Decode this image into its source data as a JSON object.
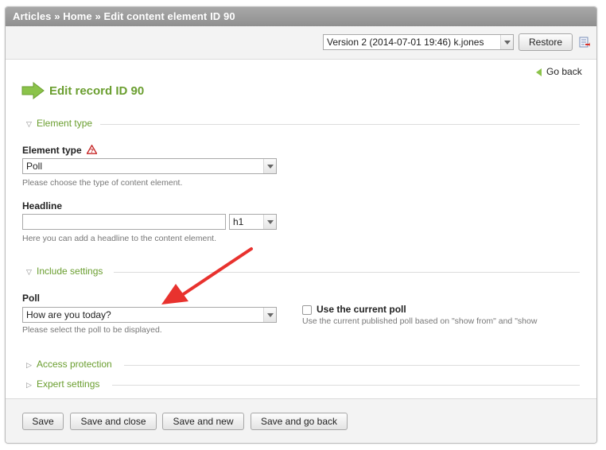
{
  "breadcrumb": "Articles » Home » Edit content element ID 90",
  "version": {
    "selected": "Version 2 (2014-07-01 19:46) k.jones",
    "restore_label": "Restore"
  },
  "go_back_label": "Go back",
  "record_title": "Edit record ID 90",
  "sections": {
    "element_type": "Element type",
    "include_settings": "Include settings",
    "access_protection": "Access protection",
    "expert_settings": "Expert settings"
  },
  "fields": {
    "element_type": {
      "label": "Element type",
      "value": "Poll",
      "help": "Please choose the type of content element."
    },
    "headline": {
      "label": "Headline",
      "value": "",
      "unit": "h1",
      "help": "Here you can add a headline to the content element."
    },
    "poll": {
      "label": "Poll",
      "value": "How are you today?",
      "help": "Please select the poll to be displayed."
    },
    "use_current_poll": {
      "label": "Use the current poll",
      "checked": false,
      "help": "Use the current published poll based on \"show from\" and \"show"
    }
  },
  "buttons": {
    "save": "Save",
    "save_close": "Save and close",
    "save_new": "Save and new",
    "save_back": "Save and go back"
  },
  "colors": {
    "accent_green": "#6a9e2f",
    "annotation_arrow": "#e8322e"
  }
}
